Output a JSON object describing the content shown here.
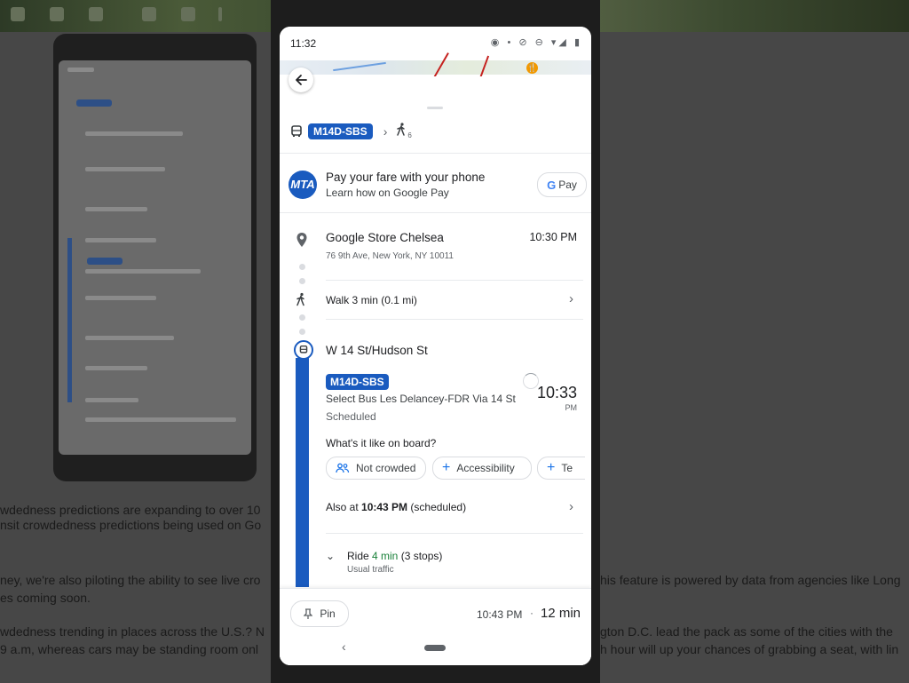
{
  "background": {
    "article_lines": [
      {
        "left": "wdedness predictions are expanding to over 10",
        "right": ""
      },
      {
        "left": "nsit crowdedness predictions being used on Go",
        "right": ""
      },
      {
        "left": "ney, we're also piloting the ability to see live cro",
        "right": "his feature is powered by data from agencies like Long"
      },
      {
        "left": "es coming soon.",
        "right": ""
      },
      {
        "left": "wdedness trending in places across the U.S.? N",
        "right": "gton D.C. lead the pack as some of the cities with the"
      },
      {
        "left": "9 a.m, whereas cars may be standing room onl",
        "right": "h hour will up your chances of grabbing a seat, with lin"
      }
    ]
  },
  "status_bar": {
    "time": "11:32",
    "icons": "◉  •  ⊘ ⊖ ▾◢ ▮"
  },
  "map": {
    "poi_icon": "restaurant-icon",
    "poi_glyph": "🍴"
  },
  "route_summary": {
    "bus_line": "M14D-SBS",
    "walk_minutes": "6",
    "chevron": "›"
  },
  "payment": {
    "logo_text": "MTA",
    "title": "Pay your fare with your phone",
    "subtitle": "Learn how on Google Pay",
    "button_g": "G",
    "button_label": "Pay"
  },
  "destination": {
    "title": "Google Store Chelsea",
    "address": "76 9th Ave, New York, NY 10011",
    "time": "10:30 PM"
  },
  "walk_step": {
    "label": "Walk 3 min (0.1 mi)",
    "chevron": "›"
  },
  "transit_step": {
    "stop_name": "W 14 St/Hudson St",
    "line_badge": "M14D-SBS",
    "headsign": "Select Bus Les Delancey-FDR Via 14 St",
    "status": "Scheduled",
    "departure_time": "10:33",
    "departure_ampm": "PM",
    "onboard_question": "What's it like on board?",
    "chips": [
      "Not crowded",
      "Accessibility",
      "Te"
    ],
    "also_prefix": "Also at ",
    "also_time": "10:43 PM",
    "also_suffix": " (scheduled)",
    "also_chevron": "›",
    "ride_prefix": "Ride ",
    "ride_duration": "4 min",
    "ride_suffix": " (3 stops)",
    "ride_sub": "Usual traffic",
    "ride_chevron": "⌄"
  },
  "footer": {
    "pin_label": "Pin",
    "arrival_time": "10:43 PM",
    "separator": "·",
    "duration": "12 min"
  },
  "nav_bar": {
    "back_glyph": "‹"
  },
  "colors": {
    "transit_blue": "#1a5bbf",
    "accent_blue": "#1a73e8",
    "green": "#188038"
  }
}
